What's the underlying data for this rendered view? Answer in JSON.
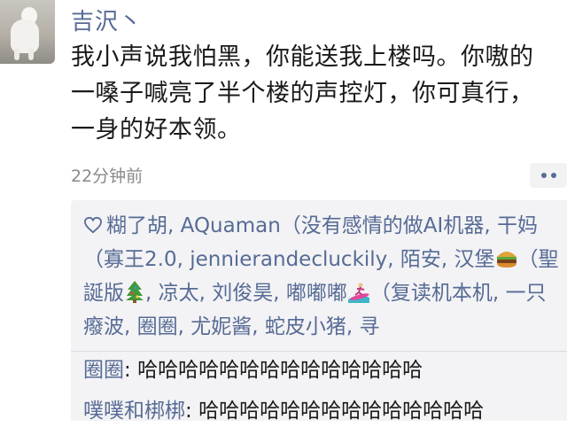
{
  "post": {
    "username": "吉沢丶",
    "text": "我小声说我怕黑，你能送我上楼吗。你嗷的一嗓子喊亮了半个楼的声控灯，你可真行，一身的好本领。",
    "timestamp": "22分钟前"
  },
  "likes": {
    "segments": [
      "糊了胡, AQuaman（没有感情的做AI机器, 干妈（寡王2.0, jennierandecluckily, 陌安, 汉堡",
      "（聖誕版",
      ", 凉太, 刘俊昊, 嘟嘟嘟",
      "（复读机本机, 一只癈波, 圈圈, 尤妮酱, 蛇皮小猪, 寻"
    ],
    "icons": [
      "heart-icon",
      "hamburger-icon",
      "christmas-tree-icon",
      "surfer-icon"
    ]
  },
  "comments": [
    {
      "name": "圈圈",
      "separator": ": ",
      "text": "哈哈哈哈哈哈哈哈哈哈哈哈哈哈"
    },
    {
      "name": "噗噗和梆梆",
      "separator": ": ",
      "text": "哈哈哈哈哈哈哈哈哈哈哈哈哈哈"
    }
  ],
  "colors": {
    "link": "#576b95",
    "panel": "#f3f3f5",
    "timestamp": "#8a8a8a"
  }
}
